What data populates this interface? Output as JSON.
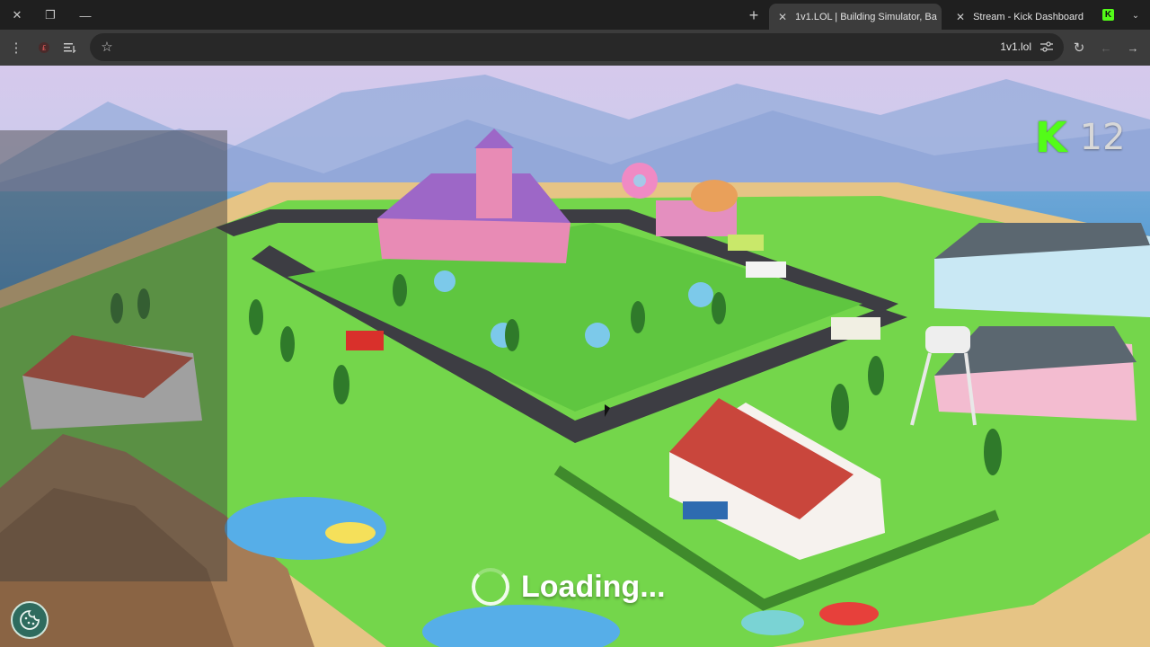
{
  "window": {
    "close_glyph": "✕",
    "restore_glyph": "❐",
    "minimize_glyph": "—",
    "new_tab_glyph": "+"
  },
  "tabs": [
    {
      "label": "1v1.LOL | Building Simulator, Ba",
      "active": true,
      "favicon_color": "#5b6aa6"
    },
    {
      "label": "Stream - Kick Dashboard",
      "active": false,
      "favicon_color": "#53fc18"
    }
  ],
  "toolbar": {
    "url": "1v1.lol",
    "bookmark_glyph": "☆",
    "reload_glyph": "↻",
    "back_glyph": "←",
    "forward_glyph": "→"
  },
  "kick": {
    "logo_letter": "K",
    "viewer_count": "12"
  },
  "loading": {
    "text": "Loading..."
  },
  "colors": {
    "kick_green": "#53fc18",
    "sky": "#b9d3ee",
    "grass": "#6fd64a",
    "road": "#3a3a3f"
  }
}
